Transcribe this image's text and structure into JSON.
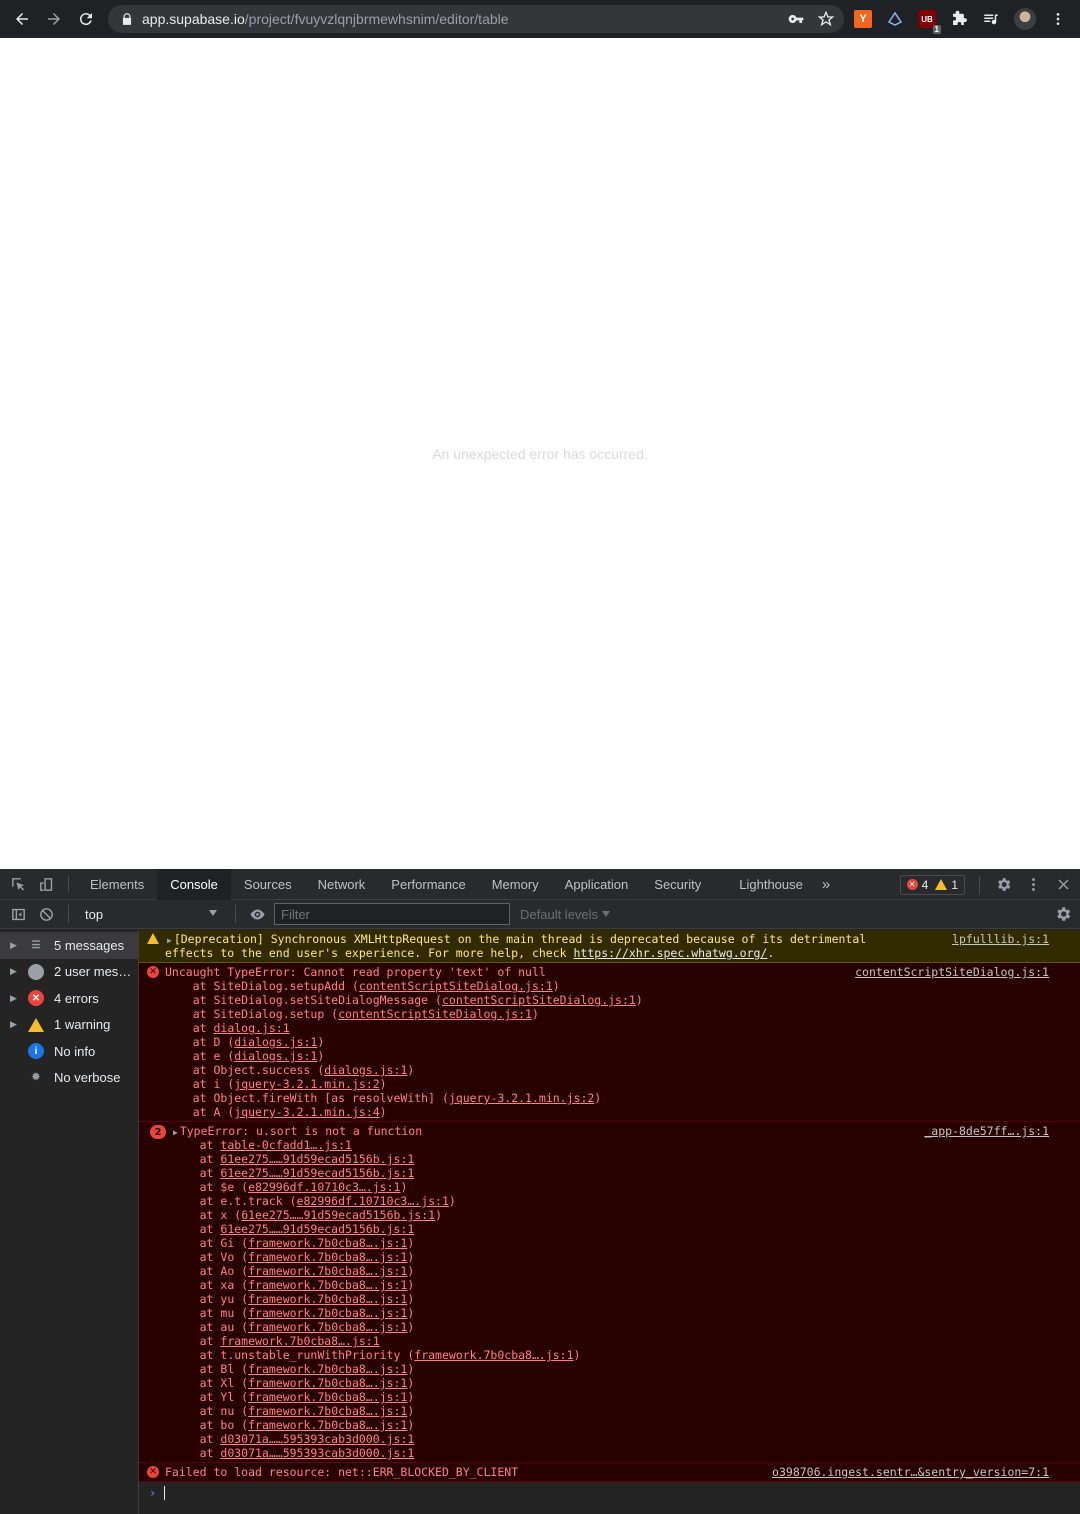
{
  "browser": {
    "url_host": "app.supabase.io",
    "url_path": "/project/fvuyvzlqnjbrmewhsnim/editor/table",
    "extensions": [
      {
        "name": "y-combinator-extension",
        "label": "Y"
      },
      {
        "name": "ublock-extension",
        "label": "UB",
        "badge": "1"
      }
    ]
  },
  "page": {
    "message": "An unexpected error has occurred."
  },
  "devtools": {
    "tabs": [
      "Elements",
      "Console",
      "Sources",
      "Network",
      "Performance",
      "Memory",
      "Application",
      "Security",
      "Lighthouse"
    ],
    "active_tab": "Console",
    "error_count": "4",
    "warning_count": "1",
    "context": "top",
    "filter_placeholder": "Filter",
    "levels_label": "Default levels",
    "sidebar": [
      {
        "label": "5 messages",
        "icon": "list-icon",
        "expandable": true
      },
      {
        "label": "2 user mes…",
        "icon": "user-icon",
        "expandable": true
      },
      {
        "label": "4 errors",
        "icon": "error-icon",
        "expandable": true
      },
      {
        "label": "1 warning",
        "icon": "warning-icon",
        "expandable": true
      },
      {
        "label": "No info",
        "icon": "info-icon",
        "expandable": false
      },
      {
        "label": "No verbose",
        "icon": "bug-icon",
        "expandable": false
      }
    ],
    "messages": {
      "warning": {
        "line1": "[Deprecation] Synchronous XMLHttpRequest on the main thread is deprecated because of its detrimental",
        "line2_prefix": "effects to the end user's experience. For more help, check ",
        "line2_link": "https://xhr.spec.whatwg.org/",
        "line2_suffix": ".",
        "source": "lpfulllib.js:1"
      },
      "error1": {
        "title": "Uncaught TypeError: Cannot read property 'text' of null",
        "source": "contentScriptSiteDialog.js:1",
        "stack": [
          {
            "fn": "SiteDialog.setupAdd",
            "file": "contentScriptSiteDialog.js:1"
          },
          {
            "fn": "SiteDialog.setSiteDialogMessage",
            "file": "contentScriptSiteDialog.js:1"
          },
          {
            "fn": "SiteDialog.setup",
            "file": "contentScriptSiteDialog.js:1"
          },
          {
            "fn": "",
            "file": "dialog.js:1"
          },
          {
            "fn": "D",
            "file": "dialogs.js:1"
          },
          {
            "fn": "e",
            "file": "dialogs.js:1"
          },
          {
            "fn": "Object.success",
            "file": "dialogs.js:1"
          },
          {
            "fn": "i",
            "file": "jquery-3.2.1.min.js:2"
          },
          {
            "fn": "Object.fireWith [as resolveWith]",
            "file": "jquery-3.2.1.min.js:2"
          },
          {
            "fn": "A",
            "file": "jquery-3.2.1.min.js:4"
          }
        ]
      },
      "error2": {
        "count": "2",
        "title": "TypeError: u.sort is not a function",
        "source": "_app-8de57ff….js:1",
        "stack": [
          {
            "fn": "",
            "file": "table-0cfadd1….js:1"
          },
          {
            "fn": "",
            "file": "61ee275……91d59ecad5156b.js:1"
          },
          {
            "fn": "",
            "file": "61ee275……91d59ecad5156b.js:1"
          },
          {
            "fn": "$e",
            "file": "e82996df.10710c3….js:1"
          },
          {
            "fn": "e.t.track",
            "file": "e82996df.10710c3….js:1"
          },
          {
            "fn": "x",
            "file": "61ee275……91d59ecad5156b.js:1"
          },
          {
            "fn": "",
            "file": "61ee275……91d59ecad5156b.js:1"
          },
          {
            "fn": "Gi",
            "file": "framework.7b0cba8….js:1"
          },
          {
            "fn": "Vo",
            "file": "framework.7b0cba8….js:1"
          },
          {
            "fn": "Ao",
            "file": "framework.7b0cba8….js:1"
          },
          {
            "fn": "xa",
            "file": "framework.7b0cba8….js:1"
          },
          {
            "fn": "yu",
            "file": "framework.7b0cba8….js:1"
          },
          {
            "fn": "mu",
            "file": "framework.7b0cba8….js:1"
          },
          {
            "fn": "au",
            "file": "framework.7b0cba8….js:1"
          },
          {
            "fn": "",
            "file": "framework.7b0cba8….js:1"
          },
          {
            "fn": "t.unstable_runWithPriority",
            "file": "framework.7b0cba8….js:1"
          },
          {
            "fn": "Bl",
            "file": "framework.7b0cba8….js:1"
          },
          {
            "fn": "Xl",
            "file": "framework.7b0cba8….js:1"
          },
          {
            "fn": "Yl",
            "file": "framework.7b0cba8….js:1"
          },
          {
            "fn": "nu",
            "file": "framework.7b0cba8….js:1"
          },
          {
            "fn": "bo",
            "file": "framework.7b0cba8….js:1"
          },
          {
            "fn": "",
            "file": "d03071a……595393cab3d000.js:1"
          },
          {
            "fn": "",
            "file": "d03071a……595393cab3d000.js:1"
          }
        ]
      },
      "error3": {
        "title": "Failed to load resource: net::ERR_BLOCKED_BY_CLIENT",
        "source": "o398706.ingest.sentr…&sentry_version=7:1"
      }
    },
    "prompt_symbol": "›"
  }
}
